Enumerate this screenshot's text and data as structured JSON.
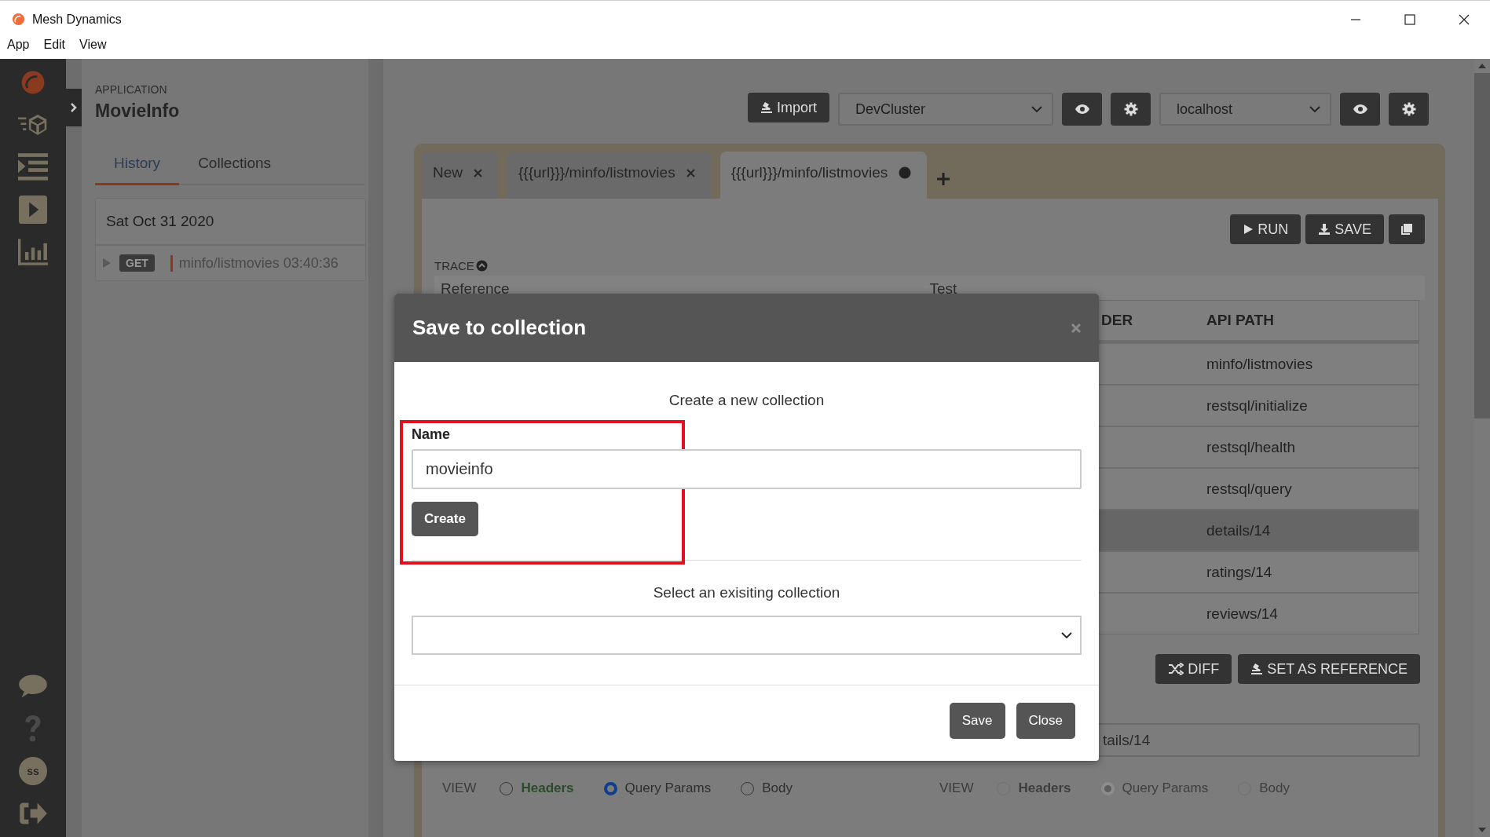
{
  "window": {
    "title": "Mesh Dynamics"
  },
  "menu": [
    "App",
    "Edit",
    "View"
  ],
  "rail": {
    "avatar": "ss"
  },
  "sidebar": {
    "caption": "APPLICATION",
    "app_name": "MovieInfo",
    "tabs": [
      {
        "label": "History",
        "selected": true
      },
      {
        "label": "Collections",
        "selected": false
      }
    ],
    "history": [
      {
        "date": "Sat Oct 31 2020",
        "entries": [
          {
            "method": "GET",
            "path": "minfo/listmovies 03:40:36"
          }
        ]
      }
    ]
  },
  "toolbar": {
    "import": "Import",
    "selects": [
      "DevCluster",
      "localhost"
    ]
  },
  "request_tabs": [
    {
      "label": "New",
      "selected": false,
      "kind": "closable"
    },
    {
      "label": "{{{url}}}/minfo/listmovies",
      "selected": false,
      "kind": "closable"
    },
    {
      "label": "{{{url}}}/minfo/listmovies",
      "selected": true,
      "kind": "unsaved"
    }
  ],
  "actions": [
    "RUN",
    "SAVE"
  ],
  "trace": {
    "label": "TRACE",
    "columns": [
      "Reference",
      "Test"
    ]
  },
  "api_table": {
    "columns": [
      "DER",
      "API PATH"
    ],
    "rows": [
      {
        "path": "minfo/listmovies",
        "selected": false
      },
      {
        "path": "restsql/initialize",
        "selected": false
      },
      {
        "path": "restsql/health",
        "selected": false
      },
      {
        "path": "restsql/query",
        "selected": false
      },
      {
        "path": "details/14",
        "selected": true
      },
      {
        "path": "ratings/14",
        "selected": false
      },
      {
        "path": "reviews/14",
        "selected": false
      }
    ]
  },
  "compare_actions": [
    "DIFF",
    "SET AS REFERENCE"
  ],
  "path_field": {
    "value": "tails/14"
  },
  "views": [
    {
      "label": "VIEW",
      "disabled": false,
      "options": [
        {
          "label": "Headers",
          "selected": false,
          "emphasized": true
        },
        {
          "label": "Query Params",
          "selected": true,
          "emphasized": false
        },
        {
          "label": "Body",
          "selected": false,
          "emphasized": false
        }
      ]
    },
    {
      "label": "VIEW",
      "disabled": true,
      "options": [
        {
          "label": "Headers",
          "selected": false,
          "emphasized": true
        },
        {
          "label": "Query Params",
          "selected": true,
          "emphasized": false
        },
        {
          "label": "Body",
          "selected": false,
          "emphasized": false
        }
      ]
    }
  ],
  "dialog": {
    "title": "Save to collection",
    "create_heading": "Create a new collection",
    "name_label": "Name",
    "name_value": "movieinfo",
    "create_button": "Create",
    "select_heading": "Select an exisiting collection",
    "buttons": [
      "Save",
      "Close"
    ],
    "highlighted": true
  }
}
